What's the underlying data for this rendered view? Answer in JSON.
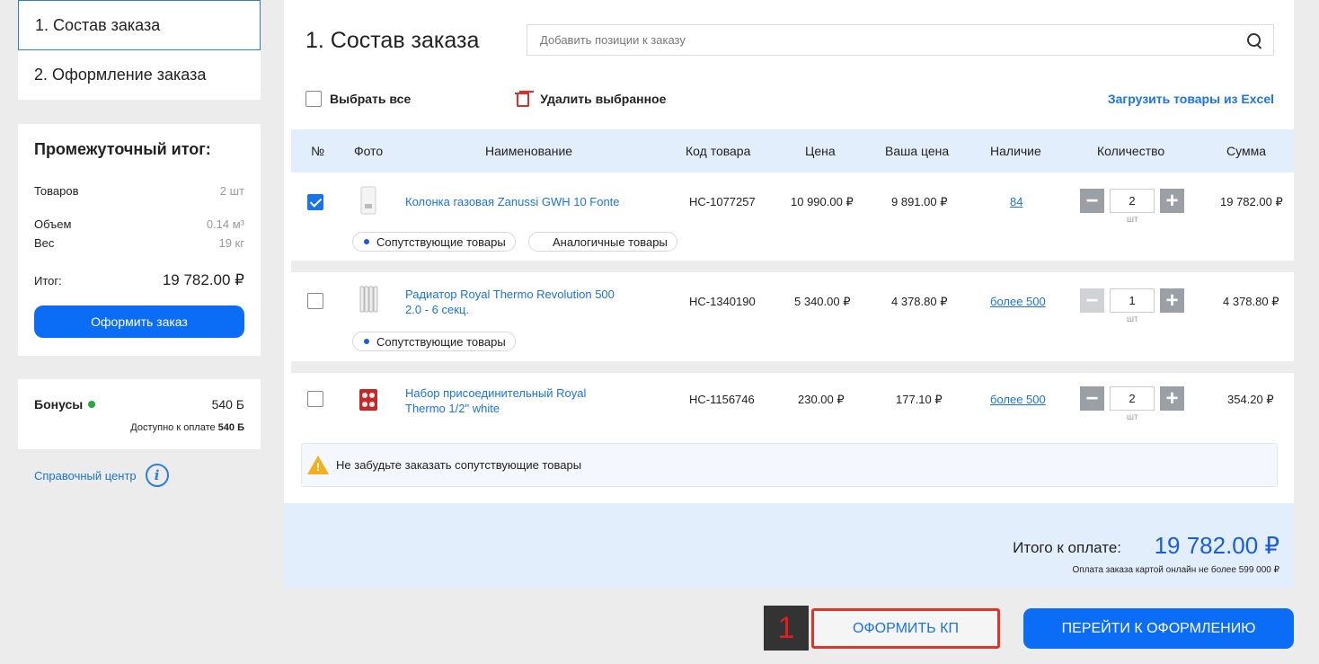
{
  "steps": [
    "1. Состав заказа",
    "2. Оформление заказа"
  ],
  "summary": {
    "title": "Промежуточный итог:",
    "items_label": "Товаров",
    "items_value": "2 шт",
    "volume_label": "Объем",
    "volume_value": "0.14 м³",
    "weight_label": "Вес",
    "weight_value": "19 кг",
    "total_label": "Итог:",
    "total_value": "19 782.00 ₽",
    "order_button": "Оформить заказ"
  },
  "bonus": {
    "label": "Бонусы",
    "value": "540 Б",
    "available_prefix": "Доступно к оплате",
    "available_value": "540 Б"
  },
  "help": {
    "label": "Справочный центр",
    "icon": "i"
  },
  "main": {
    "title": "1. Состав заказа",
    "search_placeholder": "Добавить позиции к заказу",
    "select_all": "Выбрать все",
    "delete_selected": "Удалить выбранное",
    "excel_link": "Загрузить товары из Excel"
  },
  "table": {
    "headers": [
      "№",
      "Фото",
      "Наименование",
      "Код товара",
      "Цена",
      "Ваша цена",
      "Наличие",
      "Количество",
      "Сумма"
    ],
    "rows": [
      {
        "checked": true,
        "name": "Колонка газовая Zanussi GWH 10 Fonte",
        "code": "НС-1077257",
        "price": "10 990.00 ₽",
        "your_price": "9 891.00 ₽",
        "stock": "84",
        "qty": "2",
        "unit": "шт",
        "sum": "19 782.00 ₽",
        "tags": [
          "Сопутствующие товары",
          "Аналогичные товары"
        ]
      },
      {
        "checked": false,
        "name": "Радиатор Royal Thermo Revolution 500 2.0 - 6 секц.",
        "code": "НС-1340190",
        "price": "5 340.00 ₽",
        "your_price": "4 378.80 ₽",
        "stock": "более 500",
        "qty": "1",
        "unit": "шт",
        "sum": "4 378.80 ₽",
        "tags": [
          "Сопутствующие товары"
        ]
      },
      {
        "checked": false,
        "name": "Набор присоединительный Royal Thermo 1/2\" white",
        "code": "НС-1156746",
        "price": "230.00 ₽",
        "your_price": "177.10 ₽",
        "stock": "более 500",
        "qty": "2",
        "unit": "шт",
        "sum": "354.20 ₽",
        "tags": []
      }
    ]
  },
  "notice": "Не забудьте заказать сопутствующие товары",
  "totals": {
    "label": "Итого к оплате:",
    "value": "19 782.00 ₽",
    "note": "Оплата заказа картой онлайн не более 599 000 ₽"
  },
  "step_badge": "1",
  "buttons": {
    "kp": "ОФОРМИТЬ КП",
    "checkout": "ПЕРЕЙТИ К ОФОРМЛЕНИЮ"
  },
  "colors": {
    "accent": "#0b6cf5",
    "link": "#1a73e8",
    "highlight": "#e0352b",
    "header_bg": "#e3eefc"
  },
  "icons": [
    "search-icon",
    "trash-icon",
    "checkbox-icon",
    "bonus-coin-icon",
    "info-icon",
    "warning-icon",
    "minus-icon",
    "plus-icon"
  ]
}
